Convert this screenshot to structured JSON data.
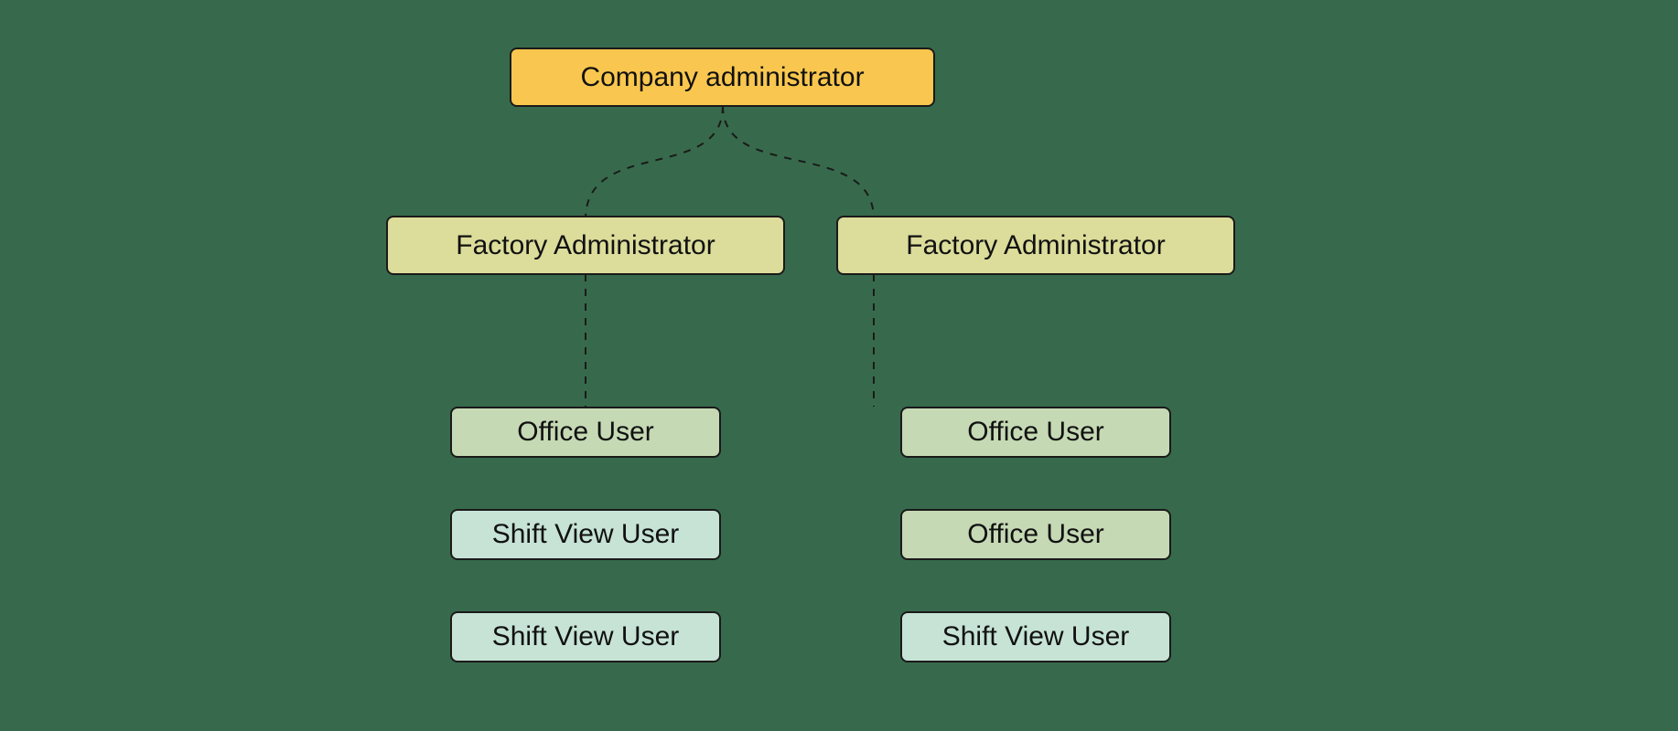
{
  "hierarchy": {
    "root": {
      "label": "Company administrator",
      "kind": "company-admin"
    },
    "branches": [
      {
        "admin": {
          "label": "Factory Administrator",
          "kind": "factory-admin"
        },
        "users": [
          {
            "label": "Office User",
            "kind": "office-user"
          },
          {
            "label": "Shift View User",
            "kind": "shift-view-user"
          },
          {
            "label": "Shift View User",
            "kind": "shift-view-user"
          }
        ]
      },
      {
        "admin": {
          "label": "Factory Administrator",
          "kind": "factory-admin"
        },
        "users": [
          {
            "label": "Office User",
            "kind": "office-user"
          },
          {
            "label": "Office User",
            "kind": "office-user"
          },
          {
            "label": "Shift View User",
            "kind": "shift-view-user"
          }
        ]
      }
    ]
  },
  "colors": {
    "background": "#376a4c",
    "company-admin": "#f9c74f",
    "factory-admin": "#dcdc9b",
    "office-user": "#c5d9b4",
    "shift-view-user": "#c6e3d6",
    "border": "#1a1a1a"
  }
}
